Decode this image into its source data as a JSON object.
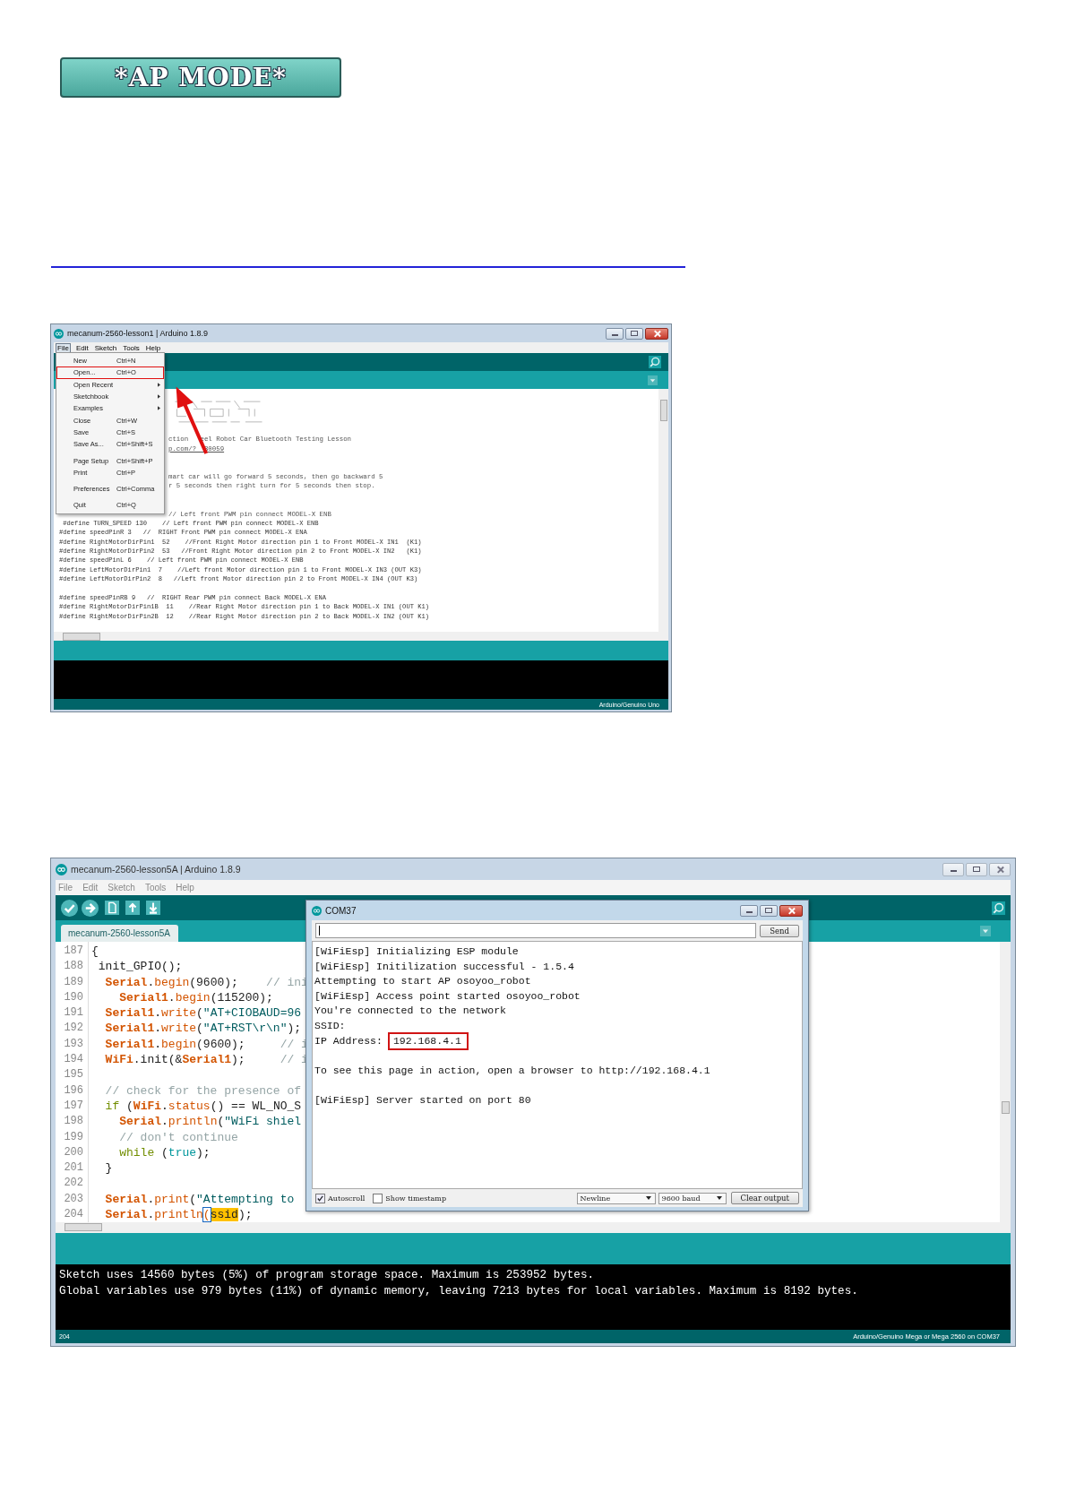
{
  "banner": {
    "title": "*AP MODE*"
  },
  "ide_window_1": {
    "title": "mecanum-2560-lesson1 | Arduino 1.8.9",
    "menu": [
      {
        "label": "File",
        "selected": true
      },
      {
        "label": "Edit",
        "selected": false
      },
      {
        "label": "Sketch",
        "selected": false
      },
      {
        "label": "Tools",
        "selected": false
      },
      {
        "label": "Help",
        "selected": false
      }
    ],
    "file_menu": [
      {
        "kind": "item",
        "label": "New",
        "shortcut": "Ctrl+N",
        "highlighted": false
      },
      {
        "kind": "item",
        "label": "Open...",
        "shortcut": "Ctrl+O",
        "highlighted": true
      },
      {
        "kind": "submenu",
        "label": "Open Recent",
        "highlighted": false
      },
      {
        "kind": "submenu",
        "label": "Sketchbook",
        "highlighted": false
      },
      {
        "kind": "submenu",
        "label": "Examples",
        "highlighted": false
      },
      {
        "kind": "item",
        "label": "Close",
        "shortcut": "Ctrl+W",
        "highlighted": false
      },
      {
        "kind": "item",
        "label": "Save",
        "shortcut": "Ctrl+S",
        "highlighted": false
      },
      {
        "kind": "item",
        "label": "Save As...",
        "shortcut": "Ctrl+Shift+S",
        "highlighted": false
      },
      {
        "kind": "separator"
      },
      {
        "kind": "item",
        "label": "Page Setup",
        "shortcut": "Ctrl+Shift+P",
        "highlighted": false
      },
      {
        "kind": "item",
        "label": "Print",
        "shortcut": "Ctrl+P",
        "highlighted": false
      },
      {
        "kind": "separator"
      },
      {
        "kind": "item",
        "label": "Preferences",
        "shortcut": "Ctrl+Comma",
        "highlighted": false
      },
      {
        "kind": "separator"
      },
      {
        "kind": "item",
        "label": "Quit",
        "shortcut": "Ctrl+Q",
        "highlighted": false
      }
    ],
    "code_lines": [
      {
        "kind": "art"
      },
      {
        "kind": "blank"
      },
      {
        "kind": "fragment",
        "text": "ction   eel Robot Car Bluetooth Testing Lesson"
      },
      {
        "kind": "link",
        "text": "p.com/?  30059"
      },
      {
        "kind": "blank"
      },
      {
        "kind": "blank"
      },
      {
        "kind": "fragment",
        "text": "mart car will go forward 5 seconds, then go backward 5"
      },
      {
        "kind": "fragment",
        "text": "r 5 seconds then right turn for 5 seconds then stop."
      },
      {
        "kind": "blank"
      },
      {
        "kind": "blank"
      },
      {
        "kind": "fragment",
        "text": "// Left front PWM pin connect MODEL-X ENB"
      },
      {
        "kind": "code",
        "text": " #define TURN_SPEED 130    // Left front PWM pin connect MODEL-X ENB"
      },
      {
        "kind": "code",
        "text": "#define speedPinR 3   //  RIGHT Front PWM pin connect MODEL-X ENA"
      },
      {
        "kind": "code",
        "text": "#define RightMotorDirPin1  52    //Front Right Motor direction pin 1 to Front MODEL-X IN1  (K1)"
      },
      {
        "kind": "code",
        "text": "#define RightMotorDirPin2  53   //Front Right Motor direction pin 2 to Front MODEL-X IN2   (K1)"
      },
      {
        "kind": "code",
        "text": "#define speedPinL 6    // Left front PWM pin connect MODEL-X ENB"
      },
      {
        "kind": "code",
        "text": "#define LeftMotorDirPin1  7    //Left front Motor direction pin 1 to Front MODEL-X IN3 (OUT K3)"
      },
      {
        "kind": "code",
        "text": "#define LeftMotorDirPin2  8   //Left front Motor direction pin 2 to Front MODEL-X IN4 (OUT K3)"
      },
      {
        "kind": "blank"
      },
      {
        "kind": "code",
        "text": "#define speedPinRB 9   //  RIGHT Rear PWM pin connect Back MODEL-X ENA"
      },
      {
        "kind": "code",
        "text": "#define RightMotorDirPin1B  11    //Rear Right Motor direction pin 1 to Back MODEL-X IN1 (OUT K1)"
      },
      {
        "kind": "code",
        "text": "#define RightMotorDirPin2B  12    //Rear Right Motor direction pin 2 to Back MODEL-X IN2 (OUT K1)"
      }
    ],
    "status_bar": {
      "board": "Arduino/Genuino Uno"
    }
  },
  "ide_window_2": {
    "title": "mecanum-2560-lesson5A | Arduino 1.8.9",
    "menu": [
      "File",
      "Edit",
      "Sketch",
      "Tools",
      "Help"
    ],
    "tabs": [
      {
        "label": "mecanum-2560-lesson5A",
        "selected": true
      }
    ],
    "code_lines": [
      {
        "number": "187",
        "tokens": [
          {
            "kind": "plain",
            "text": "{"
          }
        ]
      },
      {
        "number": "188",
        "tokens": [
          {
            "kind": "plain",
            "text": " init_GPIO();"
          }
        ]
      },
      {
        "number": "189",
        "tokens": [
          {
            "kind": "class",
            "text": "  Serial"
          },
          {
            "kind": "plain",
            "text": "."
          },
          {
            "kind": "function",
            "text": "begin"
          },
          {
            "kind": "plain",
            "text": "(9600);    "
          },
          {
            "kind": "comment",
            "text": "// ini"
          }
        ]
      },
      {
        "number": "190",
        "tokens": [
          {
            "kind": "class",
            "text": "    Serial1"
          },
          {
            "kind": "plain",
            "text": "."
          },
          {
            "kind": "function",
            "text": "begin"
          },
          {
            "kind": "plain",
            "text": "(115200);"
          }
        ]
      },
      {
        "number": "191",
        "tokens": [
          {
            "kind": "class",
            "text": "  Serial1"
          },
          {
            "kind": "plain",
            "text": "."
          },
          {
            "kind": "function",
            "text": "write"
          },
          {
            "kind": "plain",
            "text": "("
          },
          {
            "kind": "string",
            "text": "\"AT+CIOBAUD=96"
          }
        ]
      },
      {
        "number": "192",
        "tokens": [
          {
            "kind": "class",
            "text": "  Serial1"
          },
          {
            "kind": "plain",
            "text": "."
          },
          {
            "kind": "function",
            "text": "write"
          },
          {
            "kind": "plain",
            "text": "("
          },
          {
            "kind": "string",
            "text": "\"AT+RST\\r\\n\""
          },
          {
            "kind": "plain",
            "text": ");"
          }
        ]
      },
      {
        "number": "193",
        "tokens": [
          {
            "kind": "class",
            "text": "  Serial1"
          },
          {
            "kind": "plain",
            "text": "."
          },
          {
            "kind": "function",
            "text": "begin"
          },
          {
            "kind": "plain",
            "text": "(9600);     "
          },
          {
            "kind": "comment",
            "text": "// i"
          }
        ]
      },
      {
        "number": "194",
        "tokens": [
          {
            "kind": "class",
            "text": "  WiFi"
          },
          {
            "kind": "plain",
            "text": ".init(&"
          },
          {
            "kind": "class",
            "text": "Serial1"
          },
          {
            "kind": "plain",
            "text": ");     "
          },
          {
            "kind": "comment",
            "text": "// i"
          }
        ]
      },
      {
        "number": "195"
      },
      {
        "number": "196",
        "tokens": [
          {
            "kind": "comment",
            "text": "  // check for the presence of"
          }
        ]
      },
      {
        "number": "197",
        "tokens": [
          {
            "kind": "keyword",
            "text": "  if"
          },
          {
            "kind": "plain",
            "text": " ("
          },
          {
            "kind": "class",
            "text": "WiFi"
          },
          {
            "kind": "plain",
            "text": "."
          },
          {
            "kind": "function",
            "text": "status"
          },
          {
            "kind": "plain",
            "text": "() == WL_NO_S"
          }
        ]
      },
      {
        "number": "198",
        "tokens": [
          {
            "kind": "class",
            "text": "    Serial"
          },
          {
            "kind": "plain",
            "text": "."
          },
          {
            "kind": "function",
            "text": "println"
          },
          {
            "kind": "plain",
            "text": "("
          },
          {
            "kind": "string",
            "text": "\"WiFi shiel"
          }
        ]
      },
      {
        "number": "199",
        "tokens": [
          {
            "kind": "comment",
            "text": "    // don't continue"
          }
        ]
      },
      {
        "number": "200",
        "tokens": [
          {
            "kind": "keyword",
            "text": "    while"
          },
          {
            "kind": "plain",
            "text": " ("
          },
          {
            "kind": "literal",
            "text": "true"
          },
          {
            "kind": "plain",
            "text": ");"
          }
        ]
      },
      {
        "number": "201",
        "tokens": [
          {
            "kind": "plain",
            "text": "  }"
          }
        ]
      },
      {
        "number": "202"
      },
      {
        "number": "203",
        "tokens": [
          {
            "kind": "class",
            "text": "  Serial"
          },
          {
            "kind": "plain",
            "text": "."
          },
          {
            "kind": "function",
            "text": "print"
          },
          {
            "kind": "plain",
            "text": "("
          },
          {
            "kind": "string",
            "text": "\"Attempting to"
          }
        ]
      },
      {
        "number": "204",
        "tokens": [
          {
            "kind": "class",
            "text": "  Serial"
          },
          {
            "kind": "plain",
            "text": "."
          },
          {
            "kind": "function",
            "text": "println"
          },
          {
            "kind": "cursor",
            "text": "("
          },
          {
            "kind": "match",
            "text": "ssid"
          },
          {
            "kind": "plain",
            "text": ");"
          }
        ]
      }
    ],
    "console": [
      "Sketch uses 14560 bytes (5%) of program storage space. Maximum is 253952 bytes.",
      "Global variables use 979 bytes (11%) of dynamic memory, leaving 7213 bytes for local variables. Maximum is 8192 bytes."
    ],
    "status_bar": {
      "line": "204",
      "board": "Arduino/Genuino Mega or Mega 2560 on COM37"
    }
  },
  "serial_monitor": {
    "title": "COM37",
    "send_label": "Send",
    "output": [
      {
        "text": "[WiFiEsp] Initializing ESP module"
      },
      {
        "text": "[WiFiEsp] Initilization successful - 1.5.4"
      },
      {
        "text": "Attempting to start AP osoyoo_robot"
      },
      {
        "text": "[WiFiEsp] Access point started osoyoo_robot"
      },
      {
        "text": "You're connected to the network"
      },
      {
        "text": "SSID:"
      },
      {
        "text": "IP Address:",
        "boxed": "192.168.4.1"
      },
      {
        "text": "To see this page in action, open a browser to http://192.168.4.1",
        "space_before": true
      },
      {
        "text": "[WiFiEsp] Server started on port 80",
        "space_before": true
      }
    ],
    "autoscroll": {
      "label": "Autoscroll",
      "checked": true
    },
    "timestamp": {
      "label": "Show timestamp",
      "checked": false
    },
    "line_ending": "Newline",
    "baud": "9600 baud",
    "clear_label": "Clear output"
  }
}
